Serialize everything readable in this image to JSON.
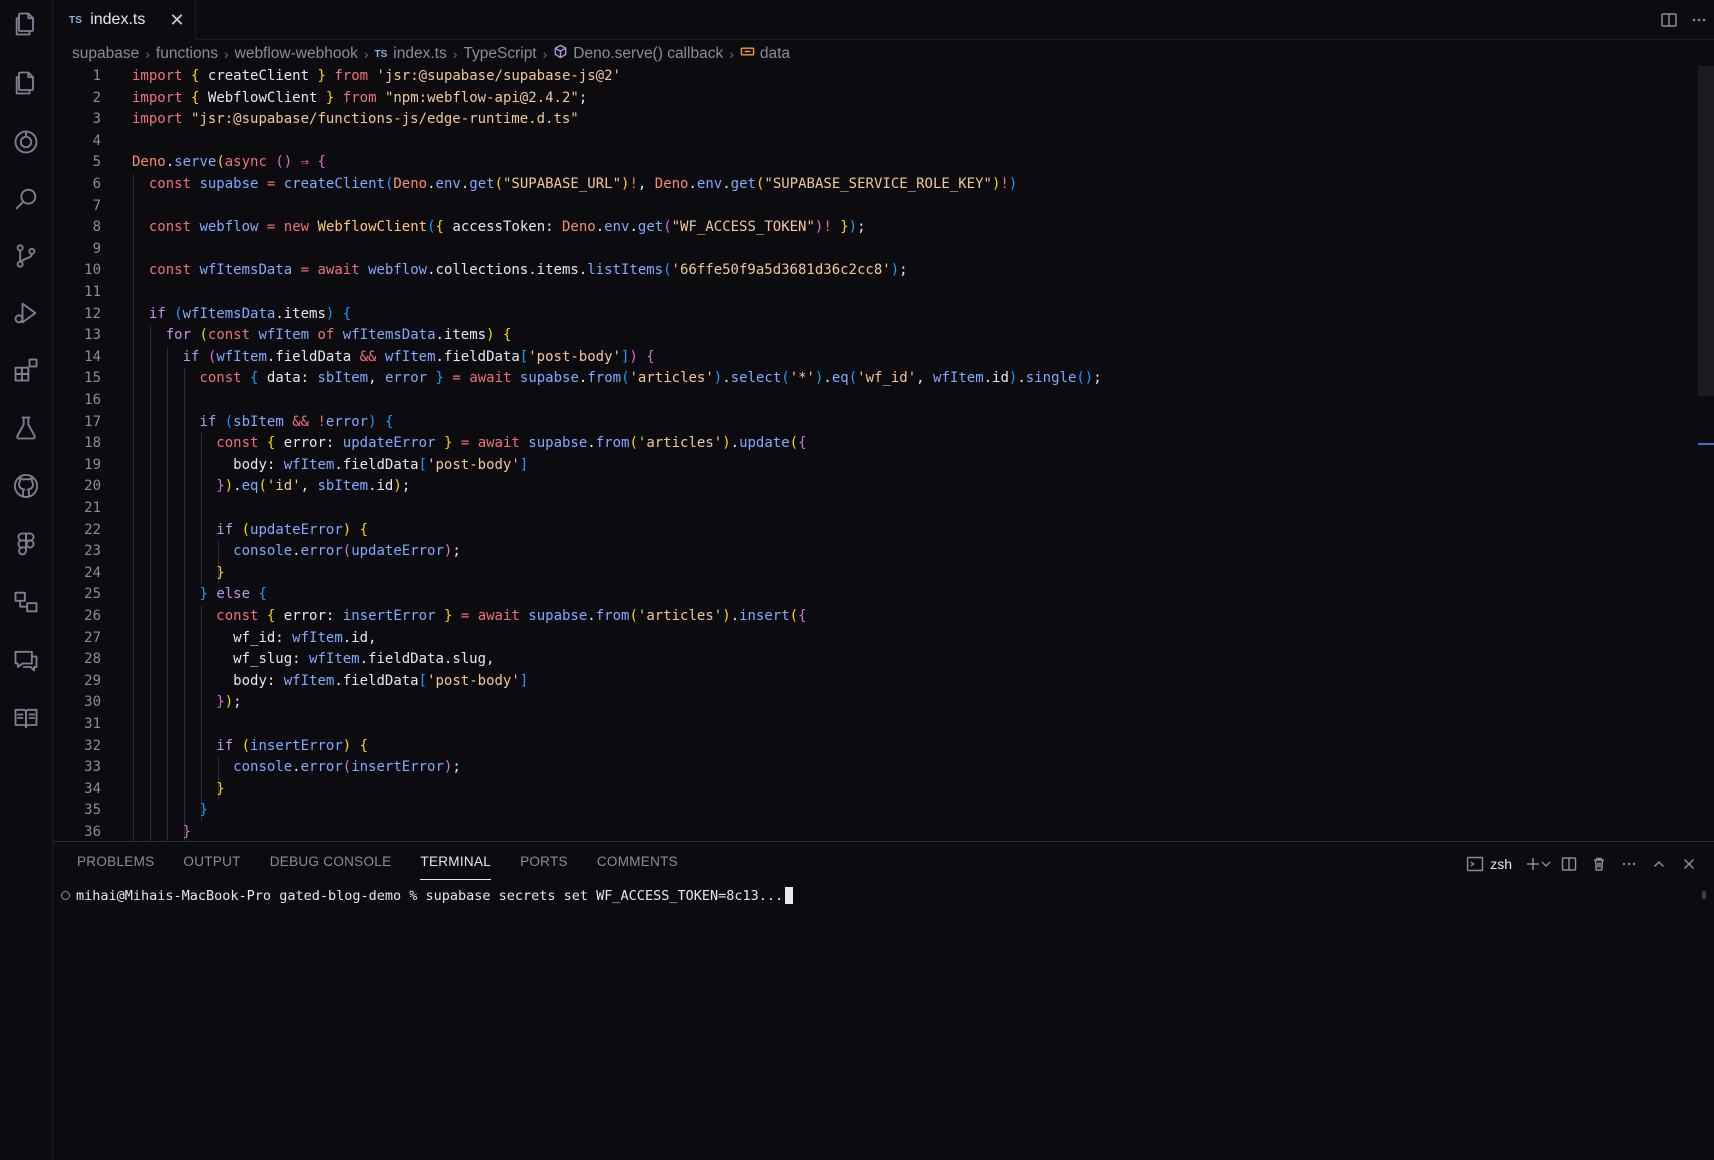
{
  "activity_bar": {
    "icons": [
      "explorer-icon",
      "files-icon",
      "copilot-icon",
      "search-icon",
      "source-control-icon",
      "run-debug-icon",
      "extensions-icon",
      "testing-icon",
      "github-icon",
      "figma-icon",
      "remote-explorer-icon",
      "chat-icon",
      "docs-icon"
    ]
  },
  "tab": {
    "lang": "TS",
    "filename": "index.ts",
    "close": "✕"
  },
  "breadcrumb": {
    "items": [
      "supabase",
      "functions",
      "webflow-webhook",
      "index.ts",
      "TypeScript",
      "Deno.serve() callback",
      "data"
    ],
    "file_lang": "TS"
  },
  "editor": {
    "line_numbers": [
      "1",
      "2",
      "3",
      "4",
      "5",
      "6",
      "7",
      "8",
      "9",
      "10",
      "11",
      "12",
      "13",
      "14",
      "15",
      "16",
      "17",
      "18",
      "19",
      "20",
      "21",
      "22",
      "23",
      "24",
      "25",
      "26",
      "27",
      "28",
      "29",
      "30",
      "31",
      "32",
      "33",
      "34",
      "35",
      "36"
    ]
  },
  "panel": {
    "tabs": [
      "PROBLEMS",
      "OUTPUT",
      "DEBUG CONSOLE",
      "TERMINAL",
      "PORTS",
      "COMMENTS"
    ],
    "active_tab": "TERMINAL",
    "shell": "zsh",
    "terminal_line": "mihai@Mihais-MacBook-Pro gated-blog-demo % supabase secrets set WF_ACCESS_TOKEN=8c13..."
  }
}
